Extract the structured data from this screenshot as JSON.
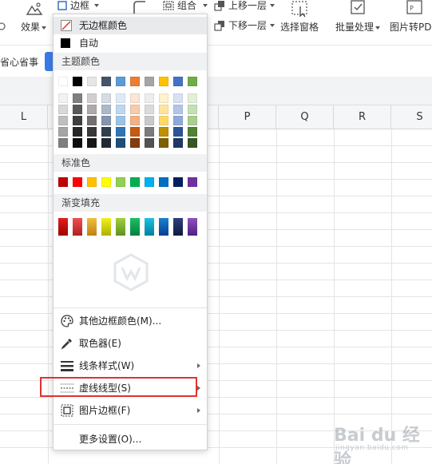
{
  "ribbon": {
    "border_label": "边框",
    "effect_label": "效果",
    "group_label": "组合",
    "bring_forward_label": "上移一层",
    "send_backward_label": "下移一层",
    "selection_pane_label": "选择窗格",
    "batch_label": "批量处理",
    "pic_to_pdf_label": "图片转PD"
  },
  "notice": {
    "text": "省心省事"
  },
  "sheet": {
    "columns": [
      "L",
      "P",
      "Q",
      "R",
      "S"
    ]
  },
  "menu": {
    "no_border_color": "无边框颜色",
    "auto": "自动",
    "theme_colors_title": "主题颜色",
    "standard_colors_title": "标准色",
    "gradient_fill_title": "渐变填充",
    "more_border_colors": "其他边框颜色(M)...",
    "color_picker": "取色器(E)",
    "line_style": "线条样式(W)",
    "dash_type": "虚线线型(S)",
    "picture_border": "图片边框(F)",
    "more_settings": "更多设置(O)...",
    "theme_top_row": [
      "#ffffff",
      "#000000",
      "#e7e6e6",
      "#44546a",
      "#5b9bd5",
      "#ed7d31",
      "#a5a5a5",
      "#ffc000",
      "#4472c4",
      "#70ad47"
    ],
    "theme_shades": [
      [
        "#f2f2f2",
        "#7f7f7f",
        "#d0cece",
        "#d6dce4",
        "#deebf6",
        "#fbe5d5",
        "#ededed",
        "#fff2cc",
        "#d9e2f3",
        "#e2efd9"
      ],
      [
        "#d8d8d8",
        "#595959",
        "#aeaaaa",
        "#adb9ca",
        "#bdd7ee",
        "#f7cbac",
        "#dbdbdb",
        "#fee599",
        "#b4c6e7",
        "#c5e0b3"
      ],
      [
        "#bfbfbf",
        "#3f3f3f",
        "#757070",
        "#8496b0",
        "#9cc3e5",
        "#f4b183",
        "#c9c9c9",
        "#ffd965",
        "#8eaadb",
        "#a8d08d"
      ],
      [
        "#a5a5a5",
        "#262626",
        "#3a3838",
        "#323f4f",
        "#2e75b5",
        "#c55a11",
        "#7b7b7b",
        "#bf9000",
        "#2f5496",
        "#538135"
      ],
      [
        "#7f7f7f",
        "#0c0c0c",
        "#171616",
        "#222a35",
        "#1e4e79",
        "#833c0b",
        "#525252",
        "#7f6000",
        "#1f3864",
        "#375623"
      ]
    ],
    "standard": [
      "#c00000",
      "#ff0000",
      "#ffc000",
      "#ffff00",
      "#92d050",
      "#00b050",
      "#00b0f0",
      "#0070c0",
      "#002060",
      "#7030a0"
    ],
    "gradients": [
      [
        "#e02020",
        "#a00000"
      ],
      [
        "#f05050",
        "#b02020"
      ],
      [
        "#f0c040",
        "#c08010"
      ],
      [
        "#f0f020",
        "#b0b000"
      ],
      [
        "#a0d040",
        "#609020"
      ],
      [
        "#20c060",
        "#008040"
      ],
      [
        "#20c0e0",
        "#0080a0"
      ],
      [
        "#2080d0",
        "#004090"
      ],
      [
        "#304080",
        "#101840"
      ],
      [
        "#9050c0",
        "#502080"
      ]
    ]
  },
  "watermark": {
    "text": "Bai du 经验",
    "sub": "jingyan.baidu.com"
  }
}
